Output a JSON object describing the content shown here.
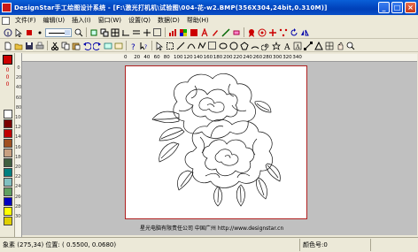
{
  "window": {
    "title": "DesignStar手工绘图设计系统 - [F:\\激光打机机\\试验图\\004-花-w2.BMP(356X304,24bit,0.310M)]",
    "btn_minimize": "_",
    "btn_maximize": "□",
    "btn_close": "×"
  },
  "menu": {
    "items": [
      "文件(F)",
      "编辑(U)",
      "插入(I)",
      "窗口(W)",
      "设置(Q)",
      "数据(D)",
      "帮助(H)"
    ]
  },
  "ruler": {
    "ticks": [
      "0",
      "20",
      "40",
      "60",
      "80",
      "100",
      "120",
      "140",
      "160",
      "180",
      "200",
      "220",
      "240",
      "260",
      "280",
      "300",
      "320",
      "340"
    ],
    "v_labels": [
      "0",
      "20",
      "40",
      "60",
      "80",
      "100",
      "120",
      "140",
      "160",
      "180",
      "200",
      "220",
      "240",
      "260",
      "280",
      "300"
    ]
  },
  "palette": {
    "current_color": "#cc0000",
    "zero_labels": [
      "0",
      "0",
      "0"
    ],
    "colors": [
      "#ffffff",
      "#7a0000",
      "#c00000",
      "#a05020",
      "#c8a080",
      "#406040",
      "#008080",
      "#80c0c0",
      "#60a060",
      "#0000c0",
      "#ffff00",
      "#e0d000"
    ]
  },
  "canvas": {
    "caption": "星光电脑有限责任公司  中国广州     http://www.designstar.cn"
  },
  "status": {
    "left": "象素 (275,34) 位置: ( 0.5500, 0.0680)",
    "right": "颜色号:0"
  }
}
